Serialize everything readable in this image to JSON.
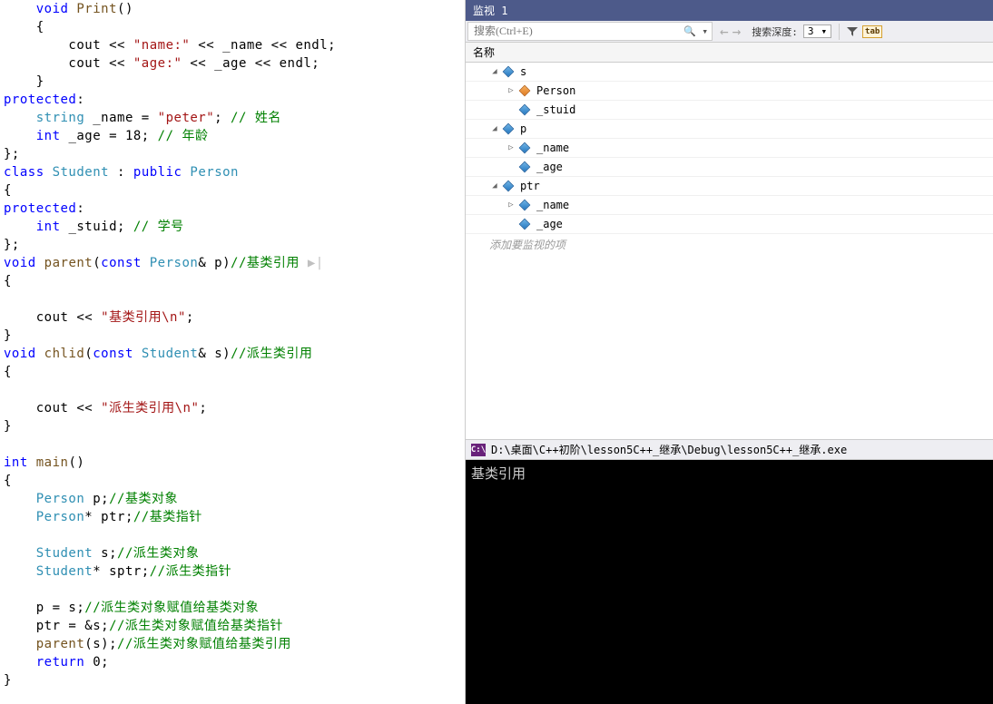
{
  "code": {
    "lines": [
      {
        "indent": 1,
        "tokens": [
          {
            "t": "void ",
            "c": "kw"
          },
          {
            "t": "Print",
            "c": "fn"
          },
          {
            "t": "()"
          }
        ]
      },
      {
        "indent": 1,
        "tokens": [
          {
            "t": "{"
          }
        ]
      },
      {
        "indent": 2,
        "tokens": [
          {
            "t": "cout << "
          },
          {
            "t": "\"name:\"",
            "c": "str"
          },
          {
            "t": " << _name << endl;"
          }
        ]
      },
      {
        "indent": 2,
        "tokens": [
          {
            "t": "cout << "
          },
          {
            "t": "\"age:\"",
            "c": "str"
          },
          {
            "t": " << _age << endl;"
          }
        ]
      },
      {
        "indent": 1,
        "tokens": [
          {
            "t": "}"
          }
        ]
      },
      {
        "indent": 0,
        "tokens": [
          {
            "t": "protected",
            "c": "kw"
          },
          {
            "t": ":"
          }
        ]
      },
      {
        "indent": 1,
        "tokens": [
          {
            "t": "string",
            "c": "type"
          },
          {
            "t": " _name = "
          },
          {
            "t": "\"peter\"",
            "c": "str"
          },
          {
            "t": "; "
          },
          {
            "t": "// 姓名",
            "c": "cmt"
          }
        ]
      },
      {
        "indent": 1,
        "tokens": [
          {
            "t": "int ",
            "c": "kw"
          },
          {
            "t": "_age = 18; "
          },
          {
            "t": "// 年龄",
            "c": "cmt"
          }
        ]
      },
      {
        "indent": 0,
        "tokens": [
          {
            "t": "};"
          }
        ]
      },
      {
        "indent": 0,
        "tokens": [
          {
            "t": "class ",
            "c": "kw"
          },
          {
            "t": "Student",
            "c": "type"
          },
          {
            "t": " : "
          },
          {
            "t": "public ",
            "c": "kw"
          },
          {
            "t": "Person",
            "c": "type"
          }
        ]
      },
      {
        "indent": 0,
        "tokens": [
          {
            "t": "{"
          }
        ]
      },
      {
        "indent": 0,
        "tokens": [
          {
            "t": "protected",
            "c": "kw"
          },
          {
            "t": ":"
          }
        ]
      },
      {
        "indent": 1,
        "tokens": [
          {
            "t": "int ",
            "c": "kw"
          },
          {
            "t": "_stuid; "
          },
          {
            "t": "// 学号",
            "c": "cmt"
          }
        ]
      },
      {
        "indent": 0,
        "tokens": [
          {
            "t": "};"
          }
        ]
      },
      {
        "indent": 0,
        "tokens": [
          {
            "t": "void ",
            "c": "kw"
          },
          {
            "t": "parent",
            "c": "fn"
          },
          {
            "t": "("
          },
          {
            "t": "const ",
            "c": "kw"
          },
          {
            "t": "Person",
            "c": "type"
          },
          {
            "t": "& p)"
          },
          {
            "t": "//基类引用 ",
            "c": "cmt"
          },
          {
            "t": "▶|",
            "c": "arrow-ind"
          }
        ]
      },
      {
        "indent": 0,
        "tokens": [
          {
            "t": "{"
          }
        ]
      },
      {
        "indent": 0,
        "tokens": [
          {
            "t": ""
          }
        ]
      },
      {
        "indent": 1,
        "tokens": [
          {
            "t": "cout << "
          },
          {
            "t": "\"基类引用\\n\"",
            "c": "str"
          },
          {
            "t": ";"
          }
        ]
      },
      {
        "indent": 0,
        "tokens": [
          {
            "t": "}"
          }
        ]
      },
      {
        "indent": 0,
        "tokens": [
          {
            "t": "void ",
            "c": "kw"
          },
          {
            "t": "chlid",
            "c": "fn"
          },
          {
            "t": "("
          },
          {
            "t": "const ",
            "c": "kw"
          },
          {
            "t": "Student",
            "c": "type"
          },
          {
            "t": "& s)"
          },
          {
            "t": "//派生类引用",
            "c": "cmt"
          }
        ]
      },
      {
        "indent": 0,
        "tokens": [
          {
            "t": "{"
          }
        ]
      },
      {
        "indent": 0,
        "tokens": [
          {
            "t": ""
          }
        ]
      },
      {
        "indent": 1,
        "tokens": [
          {
            "t": "cout << "
          },
          {
            "t": "\"派生类引用\\n\"",
            "c": "str"
          },
          {
            "t": ";"
          }
        ]
      },
      {
        "indent": 0,
        "tokens": [
          {
            "t": "}"
          }
        ]
      },
      {
        "indent": 0,
        "tokens": [
          {
            "t": ""
          }
        ]
      },
      {
        "indent": 0,
        "tokens": [
          {
            "t": "int ",
            "c": "kw"
          },
          {
            "t": "main",
            "c": "fn"
          },
          {
            "t": "()"
          }
        ]
      },
      {
        "indent": 0,
        "tokens": [
          {
            "t": "{"
          }
        ]
      },
      {
        "indent": 1,
        "tokens": [
          {
            "t": "Person",
            "c": "type"
          },
          {
            "t": " p;"
          },
          {
            "t": "//基类对象",
            "c": "cmt"
          }
        ]
      },
      {
        "indent": 1,
        "tokens": [
          {
            "t": "Person",
            "c": "type"
          },
          {
            "t": "* ptr;"
          },
          {
            "t": "//基类指针",
            "c": "cmt"
          }
        ]
      },
      {
        "indent": 0,
        "tokens": [
          {
            "t": ""
          }
        ]
      },
      {
        "indent": 1,
        "tokens": [
          {
            "t": "Student",
            "c": "type"
          },
          {
            "t": " s;"
          },
          {
            "t": "//派生类对象",
            "c": "cmt"
          }
        ]
      },
      {
        "indent": 1,
        "tokens": [
          {
            "t": "Student",
            "c": "type"
          },
          {
            "t": "* sptr;"
          },
          {
            "t": "//派生类指针",
            "c": "cmt"
          }
        ]
      },
      {
        "indent": 0,
        "tokens": [
          {
            "t": ""
          }
        ]
      },
      {
        "indent": 1,
        "tokens": [
          {
            "t": "p = s;"
          },
          {
            "t": "//派生类对象赋值给基类对象",
            "c": "cmt"
          }
        ]
      },
      {
        "indent": 1,
        "tokens": [
          {
            "t": "ptr = &s;"
          },
          {
            "t": "//派生类对象赋值给基类指针",
            "c": "cmt"
          }
        ]
      },
      {
        "indent": 1,
        "tokens": [
          {
            "t": "parent",
            "c": "fn"
          },
          {
            "t": "(s);"
          },
          {
            "t": "//派生类对象赋值给基类引用",
            "c": "cmt"
          }
        ]
      },
      {
        "indent": 1,
        "tokens": [
          {
            "t": "return ",
            "c": "kw"
          },
          {
            "t": "0;"
          }
        ]
      },
      {
        "indent": 0,
        "tokens": [
          {
            "t": "}"
          }
        ]
      }
    ]
  },
  "watch": {
    "title": "监视 1",
    "search_placeholder": "搜索(Ctrl+E)",
    "depth_label": "搜索深度:",
    "depth_value": "3",
    "header_name": "名称",
    "placeholder": "添加要监视的项",
    "tree": [
      {
        "level": 0,
        "expander": "◢",
        "icon": "blue",
        "label": "s"
      },
      {
        "level": 1,
        "expander": "▷",
        "icon": "orange",
        "label": "Person"
      },
      {
        "level": 1,
        "expander": "",
        "icon": "blue",
        "label": "_stuid"
      },
      {
        "level": 0,
        "expander": "◢",
        "icon": "blue",
        "label": "p"
      },
      {
        "level": 1,
        "expander": "▷",
        "icon": "blue",
        "label": "_name"
      },
      {
        "level": 1,
        "expander": "",
        "icon": "blue",
        "label": "_age"
      },
      {
        "level": 0,
        "expander": "◢",
        "icon": "blue",
        "label": "ptr"
      },
      {
        "level": 1,
        "expander": "▷",
        "icon": "blue",
        "label": "_name"
      },
      {
        "level": 1,
        "expander": "",
        "icon": "blue",
        "label": "_age"
      }
    ]
  },
  "console": {
    "title": "D:\\桌面\\C++初阶\\lesson5C++_继承\\Debug\\lesson5C++_继承.exe",
    "output": "基类引用"
  }
}
